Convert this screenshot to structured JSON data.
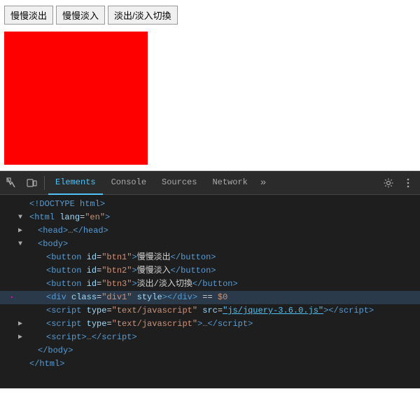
{
  "demo": {
    "buttons": [
      {
        "id": "btn1",
        "label": "慢慢淡出"
      },
      {
        "id": "btn2",
        "label": "慢慢淡入"
      },
      {
        "id": "btn3",
        "label": "淡出/淡入切換"
      }
    ]
  },
  "devtools": {
    "tabs": [
      {
        "id": "elements",
        "label": "Elements",
        "active": true
      },
      {
        "id": "console",
        "label": "Console",
        "active": false
      },
      {
        "id": "sources",
        "label": "Sources",
        "active": false
      },
      {
        "id": "network",
        "label": "Network",
        "active": false
      }
    ],
    "code": [
      {
        "indent": 0,
        "expand": false,
        "content": "<!DOCTYPE html>",
        "type": "doctype"
      },
      {
        "indent": 0,
        "expand": true,
        "collapsed": false,
        "content": "<html lang=\"en\">",
        "type": "tag"
      },
      {
        "indent": 1,
        "expand": true,
        "collapsed": true,
        "content": "<head>…</head>",
        "type": "tag"
      },
      {
        "indent": 1,
        "expand": true,
        "collapsed": false,
        "content": "<body>",
        "type": "tag-open"
      },
      {
        "indent": 2,
        "expand": false,
        "content": "<button id=\"btn1\">慢慢淡出</button>",
        "type": "line"
      },
      {
        "indent": 2,
        "expand": false,
        "content": "<button id=\"btn2\">慢慢淡入</button>",
        "type": "line"
      },
      {
        "indent": 2,
        "expand": false,
        "content": "<button id=\"btn3\">淡出/淡入切換</button>",
        "type": "line"
      },
      {
        "indent": 2,
        "expand": false,
        "content": "<div class=\"div1\" style></div> == $0",
        "type": "highlighted"
      },
      {
        "indent": 2,
        "expand": false,
        "content": "<script type=\"text/javascript\" src=\"js/jquery-3.6.0.js\"><\\/script>",
        "type": "script-link"
      },
      {
        "indent": 2,
        "expand": true,
        "collapsed": true,
        "content": "<script type=\"text/javascript\">…<\\/script>",
        "type": "script"
      },
      {
        "indent": 2,
        "expand": true,
        "collapsed": true,
        "content": "<script>…<\\/script>",
        "type": "script2"
      },
      {
        "indent": 1,
        "expand": false,
        "content": "</body>",
        "type": "tag-close"
      },
      {
        "indent": 0,
        "expand": false,
        "content": "</html>",
        "type": "tag-close2"
      }
    ]
  }
}
